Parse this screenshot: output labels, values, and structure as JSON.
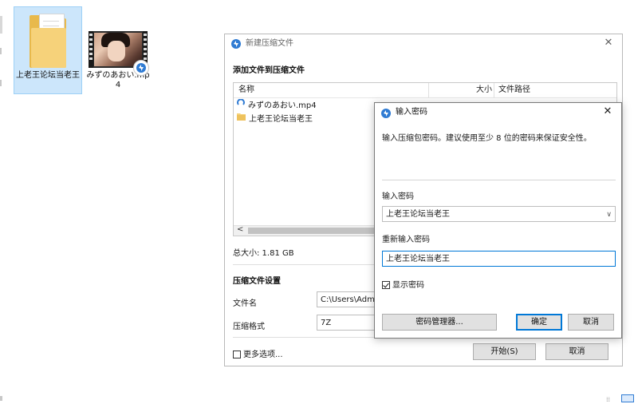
{
  "desktop": {
    "folder": {
      "label": "上老王论坛当老王"
    },
    "video": {
      "label": "みずのあおい.mp4"
    }
  },
  "main_dialog": {
    "title": "新建压缩文件",
    "section_add": "添加文件到压缩文件",
    "columns": {
      "name": "名称",
      "size": "大小",
      "path": "文件路径"
    },
    "files": [
      {
        "name": "みずのあおい.mp4",
        "icon": "video-file-icon"
      },
      {
        "name": "上老王论坛当老王",
        "icon": "folder-icon"
      }
    ],
    "total_size": "总大小: 1.81 GB",
    "section_settings": "压缩文件设置",
    "filename_label": "文件名",
    "filename_value": "C:\\Users\\Admi",
    "format_label": "压缩格式",
    "format_value": "7Z",
    "more_options": "更多选项...",
    "start_button": "开始(S)",
    "cancel_button": "取消"
  },
  "password_dialog": {
    "title": "输入密码",
    "description": "输入压缩包密码。建议使用至少 8 位的密码来保证安全性。",
    "enter_label": "输入密码",
    "enter_value": "上老王论坛当老王",
    "reenter_label": "重新输入密码",
    "reenter_value": "上老王论坛当老王",
    "show_password": "显示密码",
    "show_password_checked": true,
    "manager_button": "密码管理器...",
    "ok_button": "确定",
    "cancel_button": "取消"
  },
  "colors": {
    "accent": "#0078d7",
    "app_icon": "#2f7bd3",
    "folder": "#f6d27a",
    "selection": "#cce6fb"
  }
}
